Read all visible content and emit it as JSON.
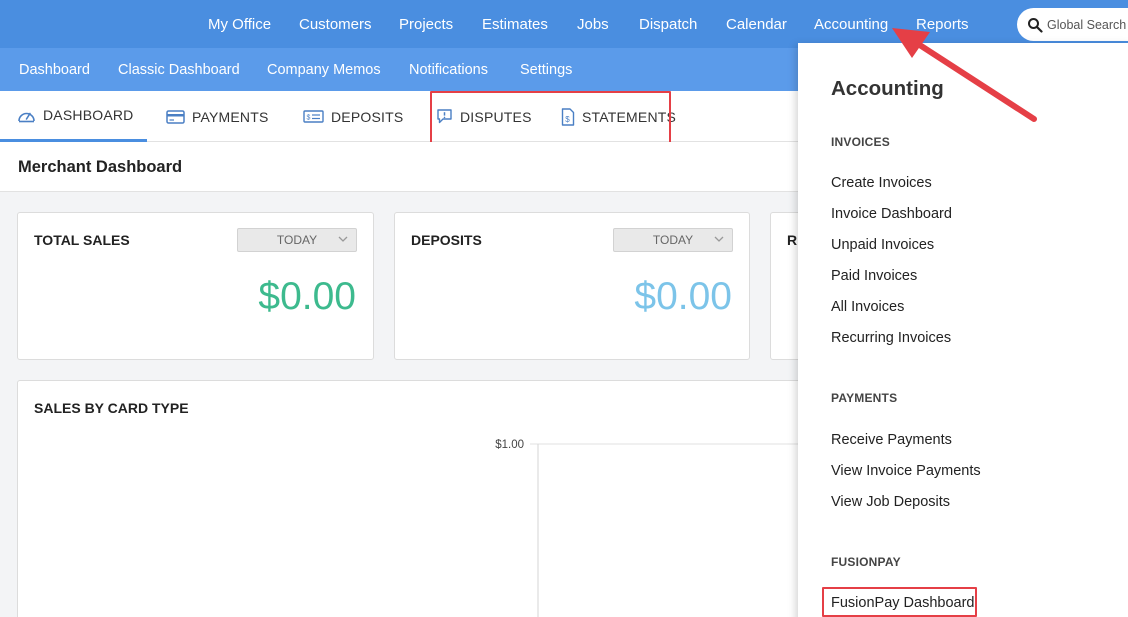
{
  "topnav": {
    "items": [
      "My Office",
      "Customers",
      "Projects",
      "Estimates",
      "Jobs",
      "Dispatch",
      "Calendar",
      "Accounting",
      "Reports"
    ],
    "search_placeholder": "Global Search"
  },
  "subnav": {
    "items": [
      "Dashboard",
      "Classic Dashboard",
      "Company Memos",
      "Notifications",
      "Settings"
    ]
  },
  "tabs": [
    {
      "label": "Dashboard",
      "icon": "speedometer-icon"
    },
    {
      "label": "Payments",
      "icon": "credit-card-icon"
    },
    {
      "label": "Deposits",
      "icon": "check-icon"
    },
    {
      "label": "Disputes",
      "icon": "speech-bubble-alert-icon"
    },
    {
      "label": "Statements",
      "icon": "document-dollar-icon"
    }
  ],
  "page_title": "Merchant Dashboard",
  "cards": [
    {
      "title": "TOTAL SALES",
      "period": "TODAY",
      "amount": "$0.00",
      "color": "#3dba8e"
    },
    {
      "title": "DEPOSITS",
      "period": "TODAY",
      "amount": "$0.00",
      "color": "#7cc4e9"
    },
    {
      "title": "R"
    }
  ],
  "chart_panel": {
    "title": "SALES BY CARD TYPE"
  },
  "chart_data": {
    "type": "bar",
    "title": "SALES BY CARD TYPE",
    "categories": [],
    "values": [],
    "y_tick_labels": [
      "$1.00"
    ],
    "ylim": [
      0,
      1
    ]
  },
  "accounting_menu": {
    "title": "Accounting",
    "sections": [
      {
        "label": "INVOICES",
        "items": [
          "Create Invoices",
          "Invoice Dashboard",
          "Unpaid Invoices",
          "Paid Invoices",
          "All Invoices",
          "Recurring Invoices"
        ]
      },
      {
        "label": "PAYMENTS",
        "items": [
          "Receive Payments",
          "View Invoice Payments",
          "View Job Deposits"
        ]
      },
      {
        "label": "FUSIONPAY",
        "items": [
          "FusionPay Dashboard"
        ]
      }
    ]
  },
  "colors": {
    "topnav": "#4a8ee0",
    "subnav": "#5b9bea",
    "highlight": "#e53f46"
  }
}
